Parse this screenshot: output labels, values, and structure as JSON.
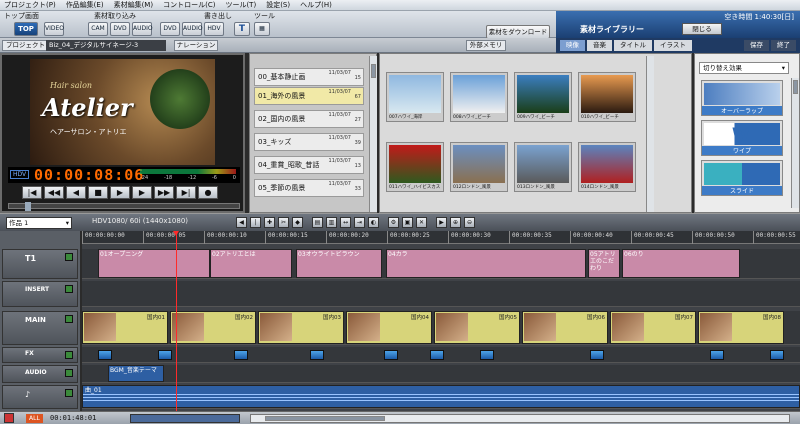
{
  "menu": [
    "プロジェクト(P)",
    "作品編集(E)",
    "素材編集(M)",
    "コントロール(C)",
    "ツール(T)",
    "設定(S)",
    "ヘルプ(H)"
  ],
  "toolbar": {
    "section_labels": [
      "トップ画面",
      "素材取り込み",
      "書き出し",
      "ツール"
    ],
    "top_label": "TOP",
    "buttons": [
      "VIDEO",
      "CAM",
      "DVD",
      "AUDIO",
      "DVD",
      "AUDIO",
      "HDV",
      "T"
    ],
    "download_label": "素材をダウンロード"
  },
  "library_header": {
    "time_info": "空き時間 1:40:30[日]",
    "title": "素材ライブラリー",
    "close_label": "閉じる",
    "tabs": [
      "映像",
      "音楽",
      "タイトル",
      "イラスト"
    ],
    "active_tab": "映像",
    "save_label": "保存",
    "end_label": "終了"
  },
  "project": {
    "label": "プロジェクト",
    "name": "Biz_04_デジタルサイネージ-3",
    "narration_label": "ナレーション",
    "external_memory_label": "外部メモリー"
  },
  "preview": {
    "overlay_top": "Hair salon",
    "overlay_title": "Atelier",
    "overlay_sub": "ヘアーサロン・アトリエ",
    "hdv_badge": "HDV",
    "timecode": "00:00:08:06",
    "meter_labels": [
      "-24",
      "-18",
      "-12",
      "-6",
      "0"
    ],
    "transport": [
      "|◀",
      "◀◀",
      "◀",
      "■",
      "▶",
      "▶",
      "▶▶",
      "▶|",
      "●"
    ]
  },
  "chapters": [
    {
      "label": "00_基本静止画",
      "date": "11/03/07",
      "num": "15"
    },
    {
      "label": "01_海外の風景",
      "date": "11/03/07",
      "num": "67"
    },
    {
      "label": "02_国内の風景",
      "date": "11/03/07",
      "num": "27"
    },
    {
      "label": "03_キッズ",
      "date": "11/03/07",
      "num": "39"
    },
    {
      "label": "04_重賞_昭歌_昔話",
      "date": "11/03/07",
      "num": "13"
    },
    {
      "label": "05_季節の風景",
      "date": "11/03/07",
      "num": "33"
    }
  ],
  "library_items": [
    {
      "caption": "007ハワイ_海岸",
      "color_a": "#8fb8e0",
      "color_b": "#d8e8f0"
    },
    {
      "caption": "008ハワイ_ビーチ",
      "color_a": "#6aa0d8",
      "color_b": "#f0f0f0"
    },
    {
      "caption": "009ハワイ_ビーチ",
      "color_a": "#3b7ec0",
      "color_b": "#1a3e18"
    },
    {
      "caption": "010ハワイ_ビーチ",
      "color_a": "#e89a50",
      "color_b": "#2b1a10"
    },
    {
      "caption": "011ハワイ_ハイビスカス",
      "color_a": "#c21a1a",
      "color_b": "#2e5a1e"
    },
    {
      "caption": "012ロンドン_風景",
      "color_a": "#6b8fc0",
      "color_b": "#8a7050"
    },
    {
      "caption": "013ロンドン_風景",
      "color_a": "#7aa2d0",
      "color_b": "#5a5a5a"
    },
    {
      "caption": "014ロンドン_風景",
      "color_a": "#5b84bf",
      "color_b": "#b02020"
    }
  ],
  "transitions": {
    "dropdown": "切り替え効果",
    "items": [
      "オーバーラップ",
      "ワイプ",
      "スライド"
    ]
  },
  "timeline": {
    "sequence_select": "作品 1",
    "format_label": "HDV1080/ 60i (1440x1080)",
    "ruler": [
      "00:00:00:00",
      "00:00:00:05",
      "00:00:00:10",
      "00:00:00:15",
      "00:00:00:20",
      "00:00:00:25",
      "00:00:00:30",
      "00:00:00:35",
      "00:00:00:40",
      "00:00:00:45",
      "00:00:00:50",
      "00:00:00:55"
    ],
    "track_heads": [
      "T1",
      "INSERT",
      "MAIN",
      "FX",
      "AUDIO",
      "♪"
    ],
    "title_clips": [
      {
        "label": "01オープニング"
      },
      {
        "label": "02アトリエとは"
      },
      {
        "label": "03オウライトビラウン"
      },
      {
        "label": "04カラ"
      },
      {
        "label": "05アトリエのこだわり"
      },
      {
        "label": "06のり"
      }
    ],
    "main_clips": [
      {
        "label": "国内01"
      },
      {
        "label": "国内02"
      },
      {
        "label": "国内03"
      },
      {
        "label": "国内04"
      },
      {
        "label": "国内05"
      },
      {
        "label": "国内06"
      },
      {
        "label": "国内07"
      },
      {
        "label": "国内08"
      }
    ],
    "audio_clip_label": "BGM_音楽テーマ",
    "music_clip_label": "曲_01"
  },
  "status": {
    "all_label": "ALL",
    "timecode": "00:01:48:01"
  },
  "colors": {
    "accent": "#1b3f72",
    "timecode": "#ff6a00",
    "playhead": "#ff2a2a",
    "title_track": "#c98aa8",
    "main_track": "#d7d47a"
  }
}
